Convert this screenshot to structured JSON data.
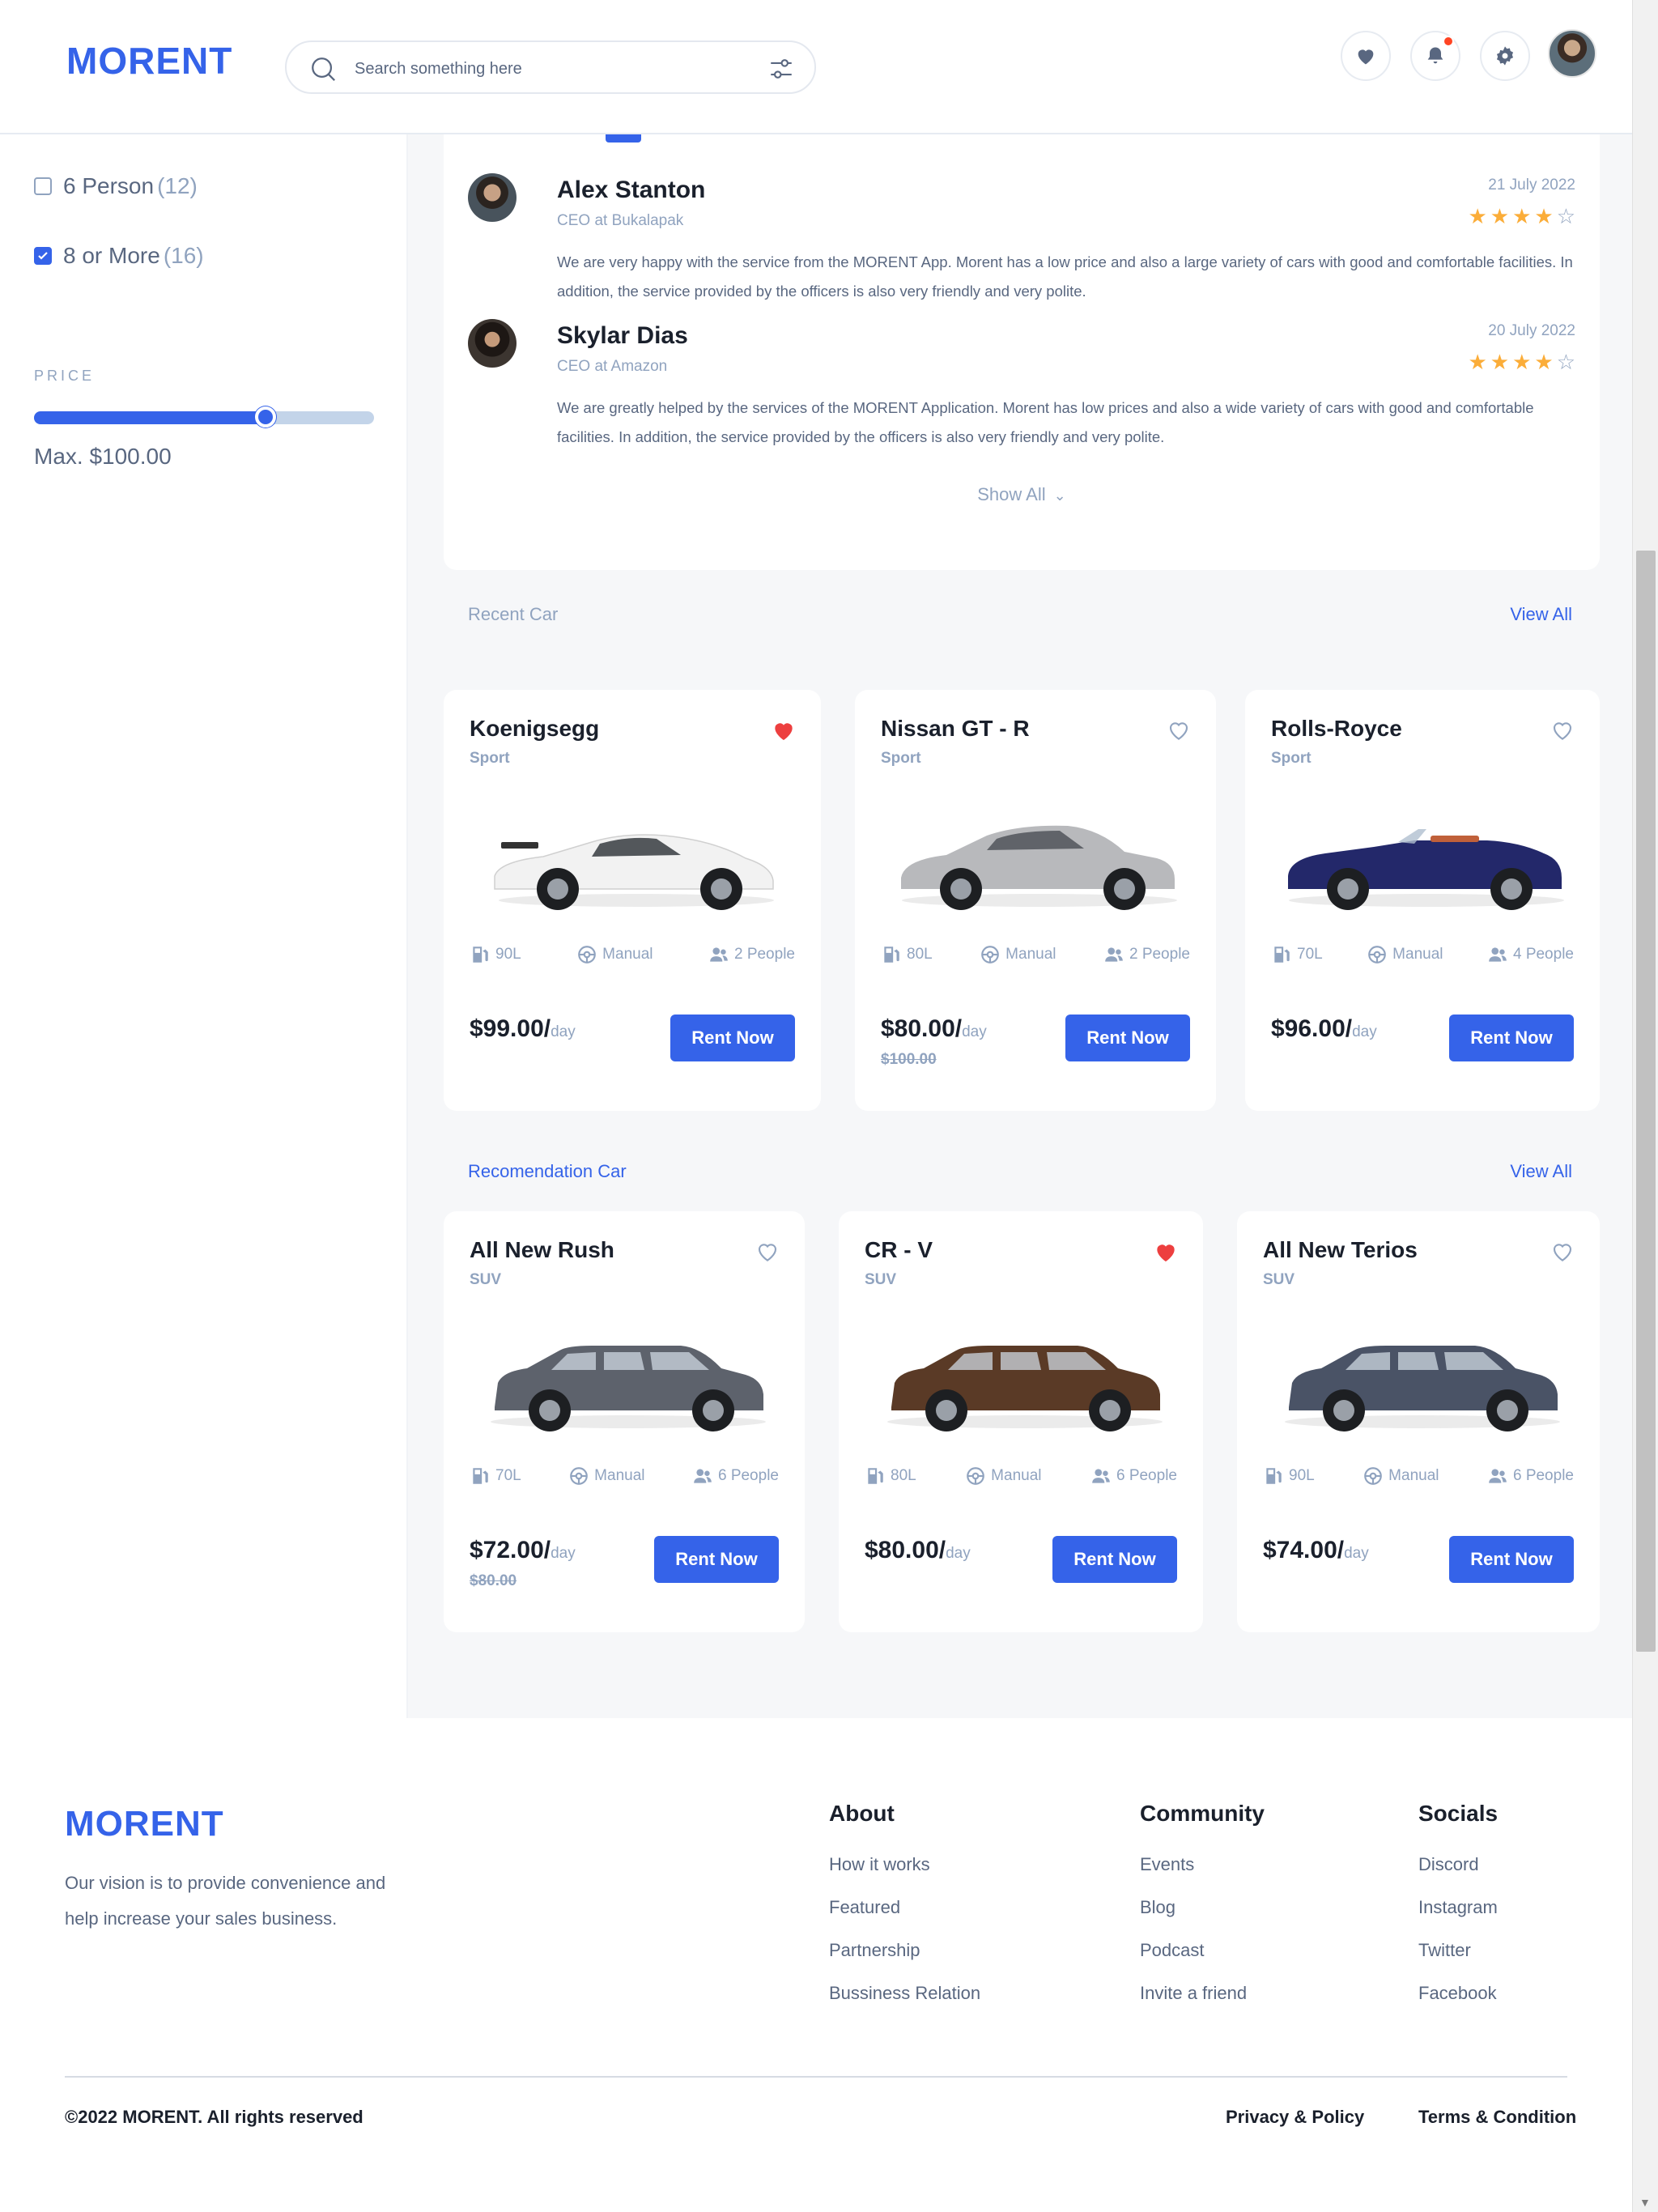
{
  "app": {
    "logo": "MORENT"
  },
  "search": {
    "placeholder": "Search something here"
  },
  "sidebar": {
    "capacity": [
      {
        "label": "6 Person",
        "count": "(12)",
        "checked": false
      },
      {
        "label": "8 or More",
        "count": "(16)",
        "checked": true
      }
    ],
    "price_title": "PRICE",
    "price_max": "Max. $100.00",
    "price_level": 0.68
  },
  "reviews": [
    {
      "name": "Alex Stanton",
      "role": "CEO at Bukalapak",
      "date": "21 July 2022",
      "rating": 4,
      "text": "We are very happy with the service from the MORENT App. Morent has a low price and also a large variety of cars with good and comfortable facilities. In addition, the service provided by the officers is also very friendly and very polite."
    },
    {
      "name": "Skylar Dias",
      "role": "CEO at Amazon",
      "date": "20 July 2022",
      "rating": 4,
      "text": "We are greatly helped by the services of the MORENT Application. Morent has low prices and also a wide variety of cars with good and comfortable facilities. In addition, the service provided by the officers is also very friendly and very polite."
    }
  ],
  "show_all": "Show All",
  "recent": {
    "title": "Recent Car",
    "view_all": "View All",
    "cars": [
      {
        "name": "Koenigsegg",
        "type": "Sport",
        "fuel": "90L",
        "trans": "Manual",
        "people": "2 People",
        "price": "$99.00/",
        "per": "day",
        "old_price": "",
        "liked": true,
        "color": "#f2f2f2",
        "kind": "sport"
      },
      {
        "name": "Nissan GT - R",
        "type": "Sport",
        "fuel": "80L",
        "trans": "Manual",
        "people": "2 People",
        "price": "$80.00/",
        "per": "day",
        "old_price": "$100.00",
        "liked": false,
        "color": "#b8b9bc",
        "kind": "coupe"
      },
      {
        "name": "Rolls-Royce",
        "type": "Sport",
        "fuel": "70L",
        "trans": "Manual",
        "people": "4 People",
        "price": "$96.00/",
        "per": "day",
        "old_price": "",
        "liked": false,
        "color": "#23286a",
        "kind": "convertible"
      }
    ]
  },
  "recommended": {
    "title": "Recomendation Car",
    "view_all": "View All",
    "cars": [
      {
        "name": "All New Rush",
        "type": "SUV",
        "fuel": "70L",
        "trans": "Manual",
        "people": "6 People",
        "price": "$72.00/",
        "per": "day",
        "old_price": "$80.00",
        "liked": false,
        "color": "#5d626c",
        "kind": "suv"
      },
      {
        "name": "CR - V",
        "type": "SUV",
        "fuel": "80L",
        "trans": "Manual",
        "people": "6 People",
        "price": "$80.00/",
        "per": "day",
        "old_price": "",
        "liked": true,
        "color": "#5a3a26",
        "kind": "suv"
      },
      {
        "name": "All New Terios",
        "type": "SUV",
        "fuel": "90L",
        "trans": "Manual",
        "people": "6 People",
        "price": "$74.00/",
        "per": "day",
        "old_price": "",
        "liked": false,
        "color": "#4a5366",
        "kind": "suv"
      }
    ]
  },
  "rent_label": "Rent Now",
  "footer": {
    "logo": "MORENT",
    "vision": "Our vision is to provide convenience and help increase your sales business.",
    "columns": [
      {
        "title": "About",
        "links": [
          "How it works",
          "Featured",
          "Partnership",
          "Bussiness Relation"
        ]
      },
      {
        "title": "Community",
        "links": [
          "Events",
          "Blog",
          "Podcast",
          "Invite a friend"
        ]
      },
      {
        "title": "Socials",
        "links": [
          "Discord",
          "Instagram",
          "Twitter",
          "Facebook"
        ]
      }
    ],
    "copyright": "©2022 MORENT. All rights reserved",
    "privacy": "Privacy & Policy",
    "terms": "Terms & Condition"
  },
  "colors": {
    "primary": "#3563e9",
    "heart": "#ed3f3f",
    "star": "#fbad39",
    "muted": "#90a3bf"
  }
}
